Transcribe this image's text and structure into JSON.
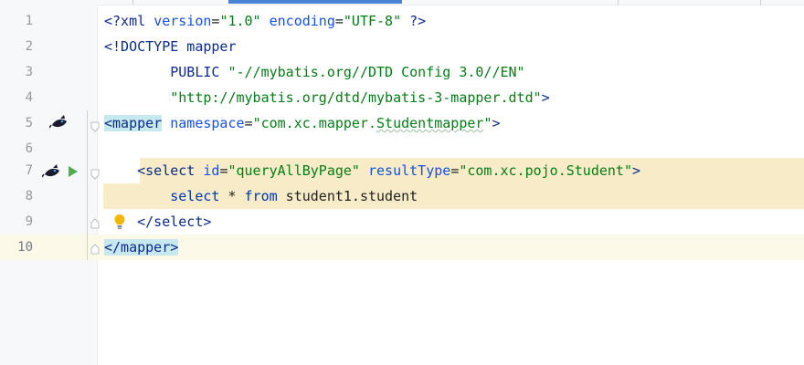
{
  "editor": {
    "lines": [
      {
        "number": "1",
        "tokens": [
          {
            "cls": "c-tag",
            "text": "<?xml "
          },
          {
            "cls": "c-attr",
            "text": "version"
          },
          {
            "cls": "c-plain",
            "text": "="
          },
          {
            "cls": "c-val",
            "text": "\"1.0\""
          },
          {
            "cls": "c-plain",
            "text": " "
          },
          {
            "cls": "c-attr",
            "text": "encoding"
          },
          {
            "cls": "c-plain",
            "text": "="
          },
          {
            "cls": "c-val",
            "text": "\"UTF-8\""
          },
          {
            "cls": "c-tag",
            "text": " ?>"
          }
        ]
      },
      {
        "number": "2",
        "tokens": [
          {
            "cls": "c-tag",
            "text": "<!DOCTYPE mapper"
          }
        ]
      },
      {
        "number": "3",
        "tokens": [
          {
            "cls": "c-tag",
            "text": "        PUBLIC "
          },
          {
            "cls": "c-val",
            "text": "\"-//mybatis.org//DTD Config 3.0//EN\""
          }
        ]
      },
      {
        "number": "4",
        "tokens": [
          {
            "cls": "c-val",
            "text": "        \"http://mybatis.org/dtd/mybatis-3-mapper.dtd\""
          },
          {
            "cls": "c-tag",
            "text": ">"
          }
        ]
      },
      {
        "number": "5",
        "tokens": [
          {
            "cls": "c-tag match",
            "text": "<mapper"
          },
          {
            "cls": "c-plain",
            "text": " "
          },
          {
            "cls": "c-attr",
            "text": "namespace"
          },
          {
            "cls": "c-plain",
            "text": "="
          },
          {
            "cls": "c-val",
            "text": "\"com.xc.mapper."
          },
          {
            "cls": "c-val typo",
            "text": "Studentmapper"
          },
          {
            "cls": "c-val",
            "text": "\""
          },
          {
            "cls": "c-tag",
            "text": ">"
          }
        ]
      },
      {
        "number": "6",
        "tokens": []
      },
      {
        "number": "7",
        "tokens": [
          {
            "cls": "c-plain",
            "text": "    "
          },
          {
            "cls": "c-tag",
            "text": "<select "
          },
          {
            "cls": "c-attr",
            "text": "id"
          },
          {
            "cls": "c-plain",
            "text": "="
          },
          {
            "cls": "c-val",
            "text": "\"queryAllByPage\""
          },
          {
            "cls": "c-plain",
            "text": " "
          },
          {
            "cls": "c-attr",
            "text": "resultType"
          },
          {
            "cls": "c-plain",
            "text": "="
          },
          {
            "cls": "c-val",
            "text": "\"com.xc.pojo.Student\""
          },
          {
            "cls": "c-tag",
            "text": ">"
          }
        ]
      },
      {
        "number": "8",
        "tokens": [
          {
            "cls": "c-plain",
            "text": "        "
          },
          {
            "cls": "c-kw",
            "text": "select"
          },
          {
            "cls": "c-plain",
            "text": " * "
          },
          {
            "cls": "c-kw",
            "text": "from"
          },
          {
            "cls": "c-plain",
            "text": " student1.student"
          }
        ]
      },
      {
        "number": "9",
        "tokens": [
          {
            "cls": "c-plain",
            "text": "    "
          },
          {
            "cls": "c-tag",
            "text": "</select>"
          }
        ]
      },
      {
        "number": "10",
        "tokens": [
          {
            "cls": "c-tag match",
            "text": "</mapper>"
          }
        ]
      }
    ]
  },
  "colors": {
    "tag": "#0c2b8c",
    "attribute": "#1750eb",
    "string": "#067d17",
    "keyword": "#0033b3",
    "tag_match_highlight": "#c6e8ee",
    "sql_injection_background": "#f7ebc8",
    "current_line_background": "#fcf9e8",
    "active_tab_indicator": "#4a83d4"
  },
  "icons": {
    "line5_gutter": "spring-bean-icon",
    "line7_gutter": [
      "spring-bean-icon",
      "run-icon"
    ],
    "line9_gutter": "lightbulb-icon",
    "fold_markers": [
      "fold-start-icon",
      "fold-start-icon",
      "fold-end-icon",
      "fold-end-icon"
    ]
  }
}
